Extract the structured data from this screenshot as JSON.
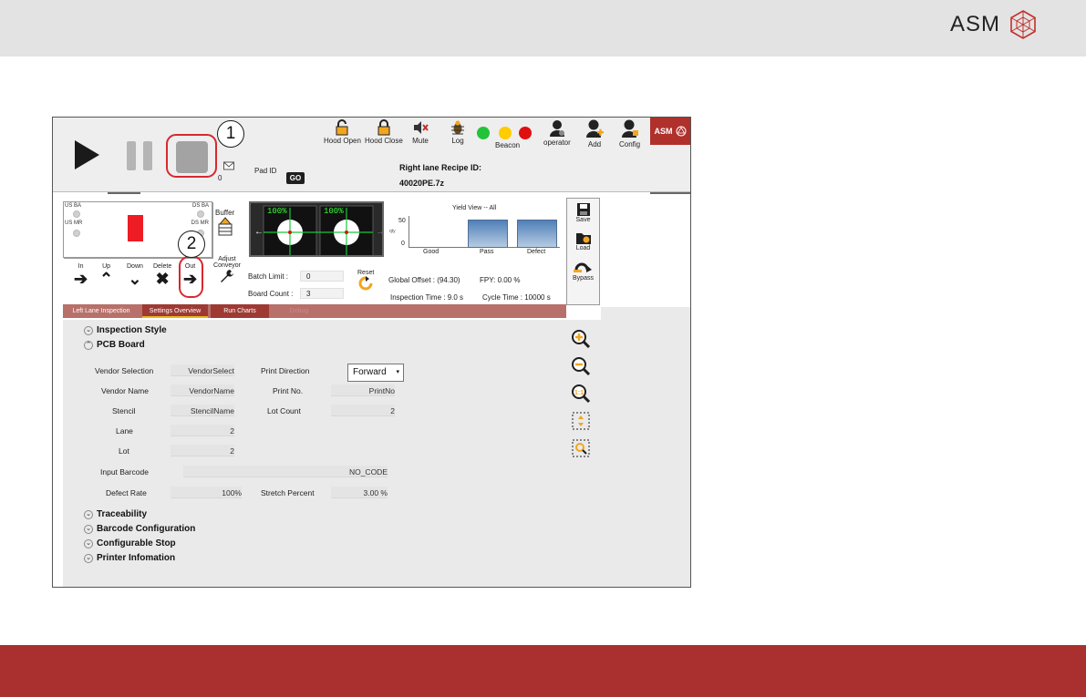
{
  "brand": {
    "name": "ASM",
    "accent": "#a9302e"
  },
  "callouts": [
    "1",
    "2"
  ],
  "toolbar": {
    "buttons": [
      {
        "label": "Hood Open",
        "icon": "lock-open-icon"
      },
      {
        "label": "Hood Close",
        "icon": "lock-closed-icon"
      },
      {
        "label": "Mute",
        "icon": "speaker-mute-icon"
      },
      {
        "label": "Log",
        "icon": "bug-icon"
      },
      {
        "label": "Beacon",
        "icon": "beacon-lights-icon"
      },
      {
        "label": "operator",
        "icon": "user-icon"
      },
      {
        "label": "Add",
        "icon": "add-user-icon"
      },
      {
        "label": "Config",
        "icon": "user-config-icon"
      }
    ],
    "beacon_colors": [
      "#2ecc40",
      "#ffcc00",
      "#e01010"
    ],
    "pad_id_label": "Pad ID",
    "go_label": "GO",
    "counter": "0",
    "recipe_label": "Right lane Recipe ID:",
    "recipe_value": "40020PE.7z",
    "badge": "ASM"
  },
  "lane": {
    "us_ba": "US BA",
    "ds_ba": "DS BA",
    "us_mr": "US MR",
    "ds_mr": "DS MR",
    "buffer": "Buffer"
  },
  "camera": {
    "left_pct": "100%",
    "right_pct": "100%"
  },
  "yield_view": {
    "title": "Yield View -- All",
    "y_tick_top": "50",
    "y_tick_bottom": "0",
    "y_axis": "qty",
    "categories": [
      "Good",
      "Pass",
      "Defect"
    ]
  },
  "side_buttons": [
    {
      "label": "Save",
      "icon": "save-icon"
    },
    {
      "label": "Load",
      "icon": "load-folder-icon"
    },
    {
      "label": "Bypass",
      "icon": "bypass-icon"
    }
  ],
  "controls": {
    "in": "In",
    "up": "Up",
    "down": "Down",
    "delete": "Delete",
    "out": "Out",
    "adjust": "Adjust Conveyor",
    "batch_limit_label": "Batch Limit :",
    "batch_limit_value": "0",
    "board_count_label": "Board Count :",
    "board_count_value": "3",
    "reset": "Reset",
    "global_offset": "Global Offset : (94.30)",
    "fpy": "FPY:  0.00   %",
    "inspection_time": "Inspection Time : 9.0 s",
    "cycle_time": "Cycle Time : 10000 s"
  },
  "tabs": [
    "Left Lane Inspection",
    "Settings Overview",
    "Run Charts",
    "Debug"
  ],
  "sections": {
    "inspection_style": "Inspection Style",
    "pcb_board": "PCB Board",
    "traceability": "Traceability",
    "barcode_configuration": "Barcode Configuration",
    "configurable_stop": "Configurable Stop",
    "printer_infomation": "Printer Infomation"
  },
  "pcb": {
    "vendor_selection_label": "Vendor Selection",
    "vendor_selection_value": "VendorSelect",
    "print_direction_label": "Print Direction",
    "print_direction_value": "Forward",
    "vendor_name_label": "Vendor Name",
    "vendor_name_value": "VendorName",
    "print_no_label": "Print No.",
    "print_no_value": "PrintNo",
    "stencil_label": "Stencil",
    "stencil_value": "StencilName",
    "lot_count_label": "Lot Count",
    "lot_count_value": "2",
    "lane_label": "Lane",
    "lane_value": "2",
    "lot_label": "Lot",
    "lot_value": "2",
    "input_barcode_label": "Input Barcode",
    "input_barcode_value": "NO_CODE",
    "defect_rate_label": "Defect Rate",
    "defect_rate_value": "100%",
    "stretch_percent_label": "Stretch Percent",
    "stretch_percent_value": "3.00  %"
  }
}
